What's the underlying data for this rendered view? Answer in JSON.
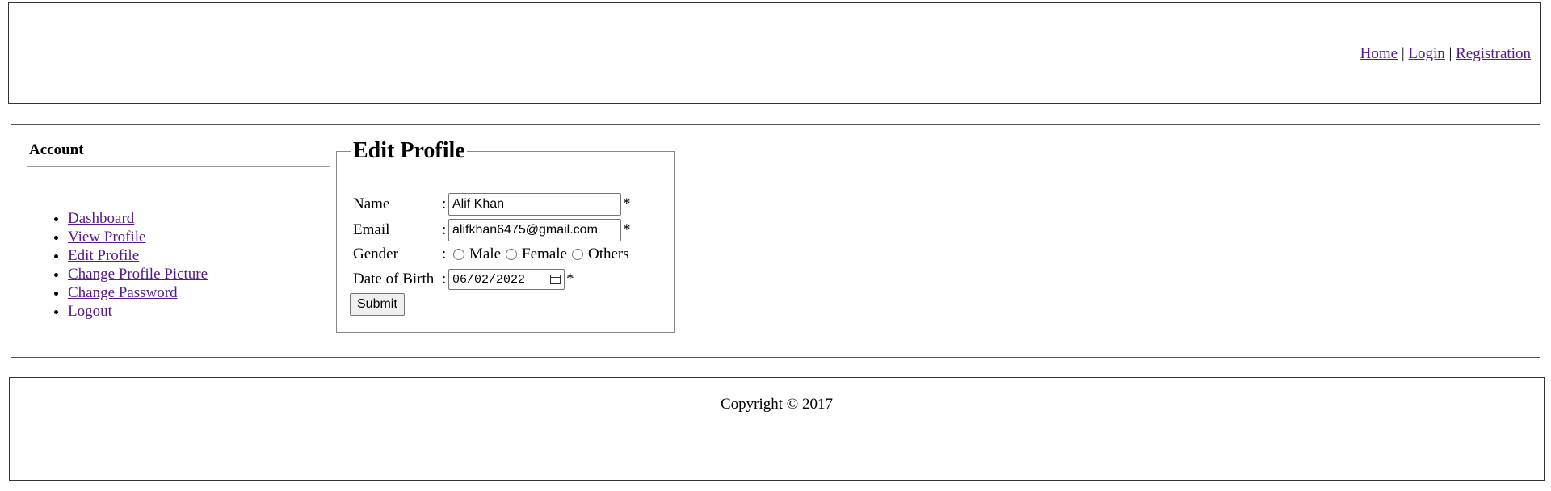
{
  "header": {
    "nav": [
      {
        "label": "Home"
      },
      {
        "label": "Login"
      },
      {
        "label": "Registration"
      }
    ],
    "separator": "|"
  },
  "sidebar": {
    "title": "Account",
    "items": [
      {
        "label": "Dashboard"
      },
      {
        "label": "View Profile"
      },
      {
        "label": "Edit Profile"
      },
      {
        "label": "Change Profile Picture"
      },
      {
        "label": "Change Password"
      },
      {
        "label": "Logout"
      }
    ]
  },
  "form": {
    "legend": "Edit Profile",
    "colon": ":",
    "required_mark": "*",
    "name": {
      "label": "Name",
      "value": "Alif Khan"
    },
    "email": {
      "label": "Email",
      "value": "alifkhan6475@gmail.com"
    },
    "gender": {
      "label": "Gender",
      "options": [
        "Male",
        "Female",
        "Others"
      ]
    },
    "dob": {
      "label": "Date of Birth",
      "value": "06/02/2022"
    },
    "submit_label": "Submit"
  },
  "footer": {
    "copyright": "Copyright © 2017"
  },
  "colors": {
    "link": "#551a8b",
    "border": "#333333"
  }
}
